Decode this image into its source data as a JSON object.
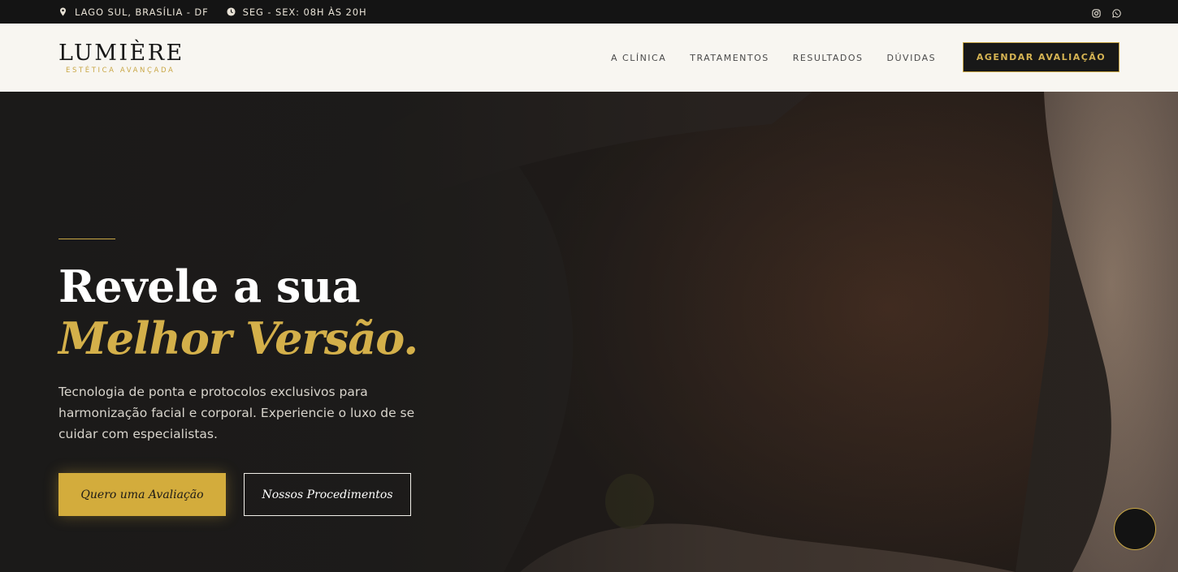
{
  "topbar": {
    "location": "LAGO SUL, BRASÍLIA - DF",
    "hours": "SEG - SEX: 08H ÀS 20H",
    "icons": [
      "map-pin-icon",
      "clock-icon",
      "instagram-icon",
      "whatsapp-icon"
    ]
  },
  "brand": {
    "name": "LUMIÈRE",
    "tagline": "ESTÉTICA AVANÇADA"
  },
  "nav": {
    "items": [
      "A CLÍNICA",
      "TRATAMENTOS",
      "RESULTADOS",
      "DÚVIDAS"
    ],
    "cta": "AGENDAR AVALIAÇÃO"
  },
  "hero": {
    "title_line1": "Revele a sua",
    "title_line2": "Melhor Versão.",
    "description": "Tecnologia de ponta e protocolos exclusivos para harmonização facial e corporal. Experiencie o luxo de se cuidar com especialistas.",
    "primary_button": "Quero uma Avaliação",
    "secondary_button": "Nossos Procedimentos"
  },
  "colors": {
    "gold": "#d3ac3c",
    "dark": "#141414",
    "cream": "#f8f6f1"
  }
}
